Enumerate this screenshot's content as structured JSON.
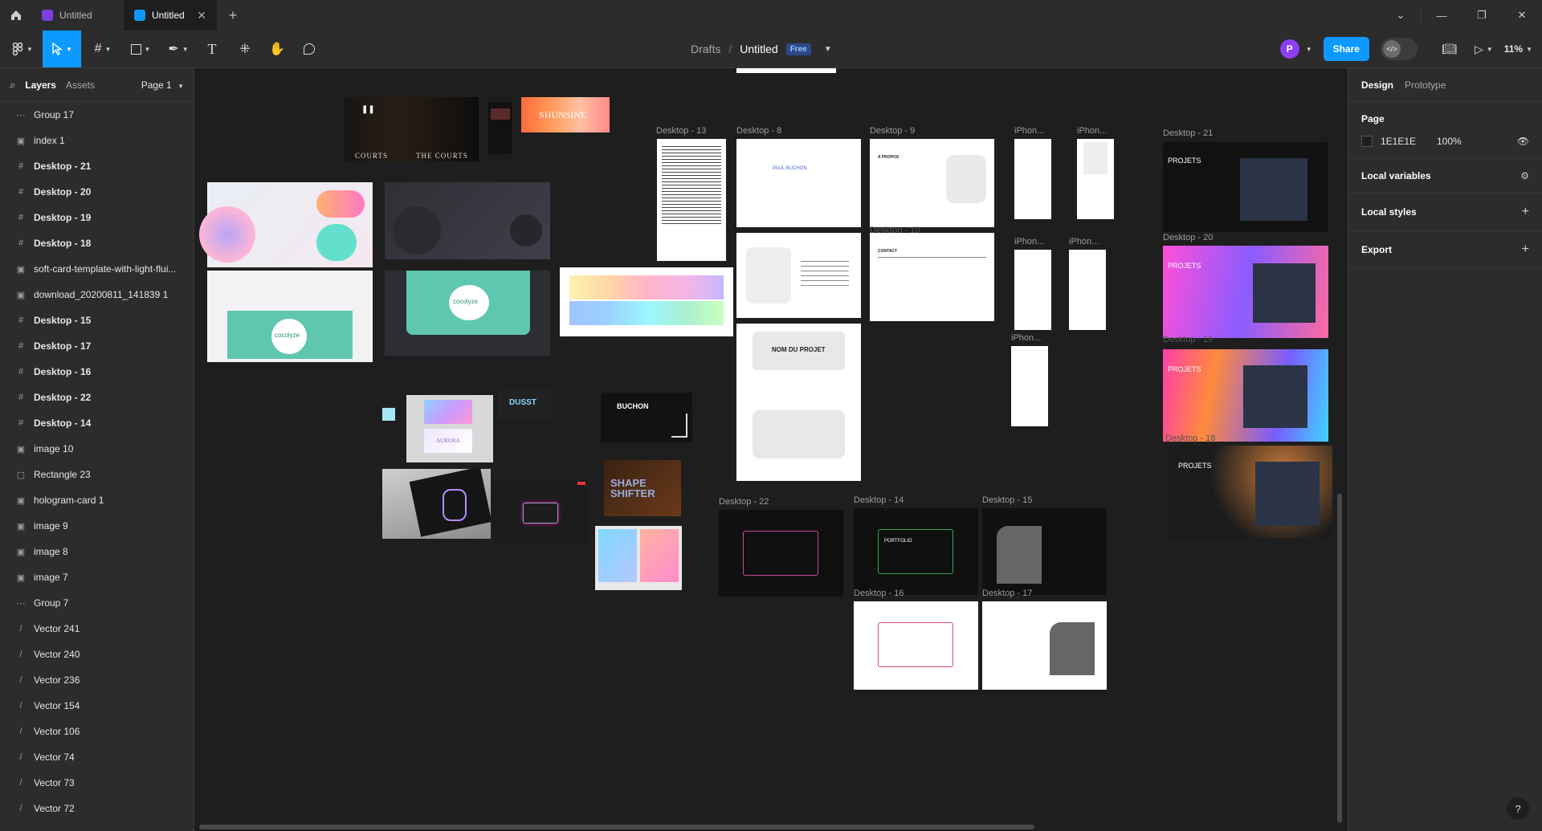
{
  "tabs": [
    {
      "label": "Untitled",
      "active": false
    },
    {
      "label": "Untitled",
      "active": true
    }
  ],
  "toolbar": {
    "drafts": "Drafts",
    "separator": "/",
    "file_title": "Untitled",
    "plan_badge": "Free",
    "avatar_initial": "P",
    "share_label": "Share",
    "zoom": "11%"
  },
  "left_panel": {
    "tab_layers": "Layers",
    "tab_assets": "Assets",
    "page_select": "Page 1",
    "layers": [
      {
        "name": "Group 17",
        "icon": "group"
      },
      {
        "name": "index 1",
        "icon": "image"
      },
      {
        "name": "Desktop - 21",
        "icon": "frame"
      },
      {
        "name": "Desktop - 20",
        "icon": "frame"
      },
      {
        "name": "Desktop - 19",
        "icon": "frame"
      },
      {
        "name": "Desktop - 18",
        "icon": "frame"
      },
      {
        "name": "soft-card-template-with-light-flui...",
        "icon": "image"
      },
      {
        "name": "download_20200811_141839 1",
        "icon": "image"
      },
      {
        "name": "Desktop - 15",
        "icon": "frame"
      },
      {
        "name": "Desktop - 17",
        "icon": "frame"
      },
      {
        "name": "Desktop - 16",
        "icon": "frame"
      },
      {
        "name": "Desktop - 22",
        "icon": "frame"
      },
      {
        "name": "Desktop - 14",
        "icon": "frame"
      },
      {
        "name": "image 10",
        "icon": "image"
      },
      {
        "name": "Rectangle 23",
        "icon": "rect"
      },
      {
        "name": "hologram-card 1",
        "icon": "image"
      },
      {
        "name": "image 9",
        "icon": "image"
      },
      {
        "name": "image 8",
        "icon": "image"
      },
      {
        "name": "image 7",
        "icon": "image"
      },
      {
        "name": "Group 7",
        "icon": "group"
      },
      {
        "name": "Vector 241",
        "icon": "vector"
      },
      {
        "name": "Vector 240",
        "icon": "vector"
      },
      {
        "name": "Vector 236",
        "icon": "vector"
      },
      {
        "name": "Vector 154",
        "icon": "vector"
      },
      {
        "name": "Vector 106",
        "icon": "vector"
      },
      {
        "name": "Vector 74",
        "icon": "vector"
      },
      {
        "name": "Vector 73",
        "icon": "vector"
      },
      {
        "name": "Vector 72",
        "icon": "vector"
      }
    ]
  },
  "right_panel": {
    "tab_design": "Design",
    "tab_prototype": "Prototype",
    "page_title": "Page",
    "page_color": "1E1E1E",
    "page_opacity": "100%",
    "local_variables": "Local variables",
    "local_styles": "Local styles",
    "export": "Export",
    "help": "?"
  },
  "canvas": {
    "labels": {
      "d13": "Desktop - 13",
      "d8": "Desktop - 8",
      "d9": "Desktop - 9",
      "iphone1": "iPhon...",
      "iphone2": "iPhon...",
      "iphone3": "iPhon...",
      "iphone4": "iPhon...",
      "iphone5": "iPhon...",
      "d21": "Desktop - 21",
      "d20": "Desktop - 20",
      "d19": "Desktop - 19",
      "d18": "Desktop - 18",
      "d22": "Desktop - 22",
      "d14": "Desktop - 14",
      "d15": "Desktop - 15",
      "d16": "Desktop - 16",
      "d17": "Desktop - 17",
      "d_clip": "Desktop - 10"
    },
    "texts": {
      "courts_a": "COURTS",
      "courts_b": "THE COURTS",
      "shunshine": "SHUNSINE",
      "cocolyze_a": "cocolyze",
      "cocolyze_b": "cocolyze",
      "buchon": "BUCHON",
      "nom_projet": "NOM DU PROJET",
      "projets_21": "PROJETS",
      "projets_20": "PROJETS",
      "projets_19": "PROJETS",
      "projets_18": "PROJETS",
      "aurora": "AURORA",
      "shape_shifter": "SHAPE SHIFTER",
      "dusst": "DUSST",
      "paul_buchon": "PAUL BUCHON",
      "portfolio": "PORTFOLIO",
      "a_propos": "A PROPOS",
      "contact": "CONTACT"
    }
  }
}
